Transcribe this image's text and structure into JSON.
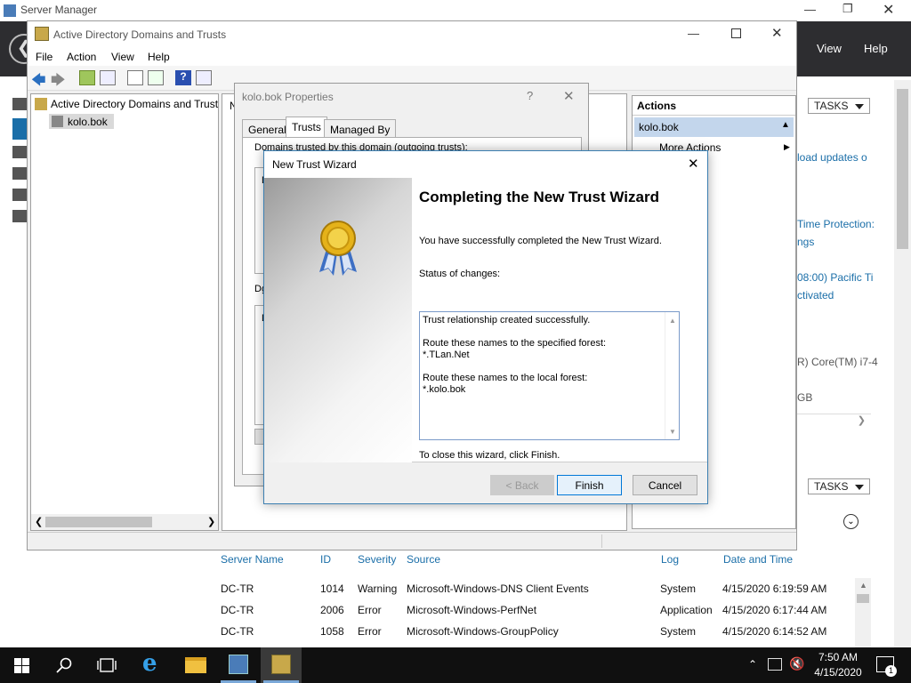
{
  "server_manager": {
    "title": "Server Manager",
    "menu": {
      "view": "View",
      "help": "Help"
    },
    "tasks_label": "TASKS",
    "right_snippets": [
      "load updates o",
      "Time Protection:",
      "ngs",
      "08:00) Pacific Ti",
      "ctivated",
      "R) Core(TM) i7-4",
      "GB"
    ],
    "events": {
      "columns": [
        "Server Name",
        "ID",
        "Severity",
        "Source",
        "Log",
        "Date and Time"
      ],
      "rows": [
        {
          "server": "DC-TR",
          "id": "1014",
          "severity": "Warning",
          "source": "Microsoft-Windows-DNS Client Events",
          "log": "System",
          "date": "4/15/2020 6:19:59 AM"
        },
        {
          "server": "DC-TR",
          "id": "2006",
          "severity": "Error",
          "source": "Microsoft-Windows-PerfNet",
          "log": "Application",
          "date": "4/15/2020 6:17:44 AM"
        },
        {
          "server": "DC-TR",
          "id": "1058",
          "severity": "Error",
          "source": "Microsoft-Windows-GroupPolicy",
          "log": "System",
          "date": "4/15/2020 6:14:52 AM"
        }
      ]
    }
  },
  "ad_window": {
    "title": "Active Directory Domains and Trusts",
    "menu": [
      "File",
      "Action",
      "View",
      "Help"
    ],
    "tree": {
      "root": "Active Directory Domains and Trust",
      "child": "kolo.bok"
    },
    "center_label": "N",
    "actions": {
      "header": "Actions",
      "selected": "kolo.bok",
      "more": "More Actions"
    }
  },
  "properties": {
    "title": "kolo.bok Properties",
    "help_glyph": "?",
    "tabs": [
      "General",
      "Trusts",
      "Managed By"
    ],
    "outgoing_label": "Domains trusted by this domain (outgoing trusts):",
    "frag_d1": "D",
    "frag_dg": "Dg",
    "frag_d2": "D"
  },
  "wizard": {
    "title": "New Trust Wizard",
    "heading": "Completing the New Trust Wizard",
    "intro": "You have successfully completed the New Trust Wizard.",
    "status_label": "Status of changes:",
    "status_lines": [
      "Trust relationship created successfully.",
      "",
      "Route these names to the specified forest:",
      "*.TLan.Net",
      "",
      "Route these names to the local forest:",
      "*.kolo.bok"
    ],
    "close_text": "To close this wizard, click Finish.",
    "buttons": {
      "back": "< Back",
      "finish": "Finish",
      "cancel": "Cancel"
    }
  },
  "taskbar": {
    "time": "7:50 AM",
    "date": "4/15/2020",
    "notification_count": "1"
  }
}
